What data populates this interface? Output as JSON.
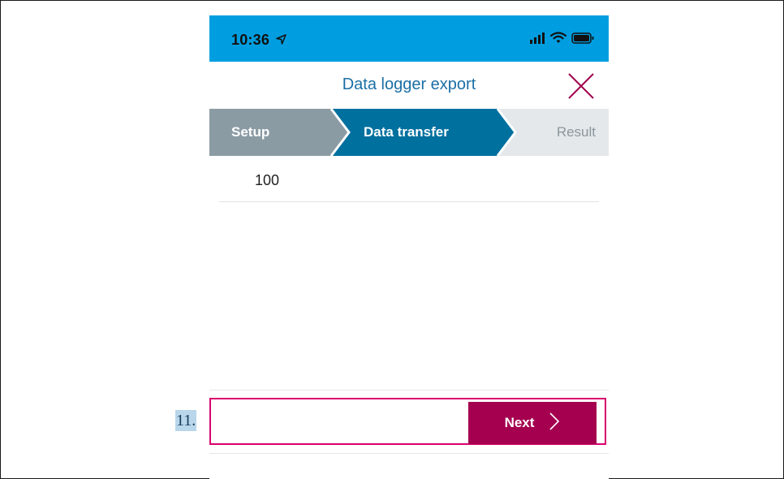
{
  "status_bar": {
    "time": "10:36",
    "location_icon": "location-arrow-icon",
    "icons": [
      "signal-icon",
      "wifi-icon",
      "battery-icon"
    ],
    "background_color": "#009ee0"
  },
  "header": {
    "title": "Data logger export",
    "close_icon": "close-icon",
    "title_color": "#1b6fa5"
  },
  "stepper": {
    "steps": [
      {
        "label": "Setup",
        "state": "completed"
      },
      {
        "label": "Data transfer",
        "state": "active"
      },
      {
        "label": "Result",
        "state": "pending"
      }
    ],
    "colors": {
      "completed": "#8b9ba4",
      "active": "#00709f",
      "pending": "#e4e8eb"
    }
  },
  "content": {
    "value": "100"
  },
  "footer": {
    "next_label": "Next",
    "next_icon": "chevron-right-icon",
    "button_color": "#a50050",
    "highlight_color": "#d9006c"
  },
  "annotation": {
    "step_number": "11."
  }
}
